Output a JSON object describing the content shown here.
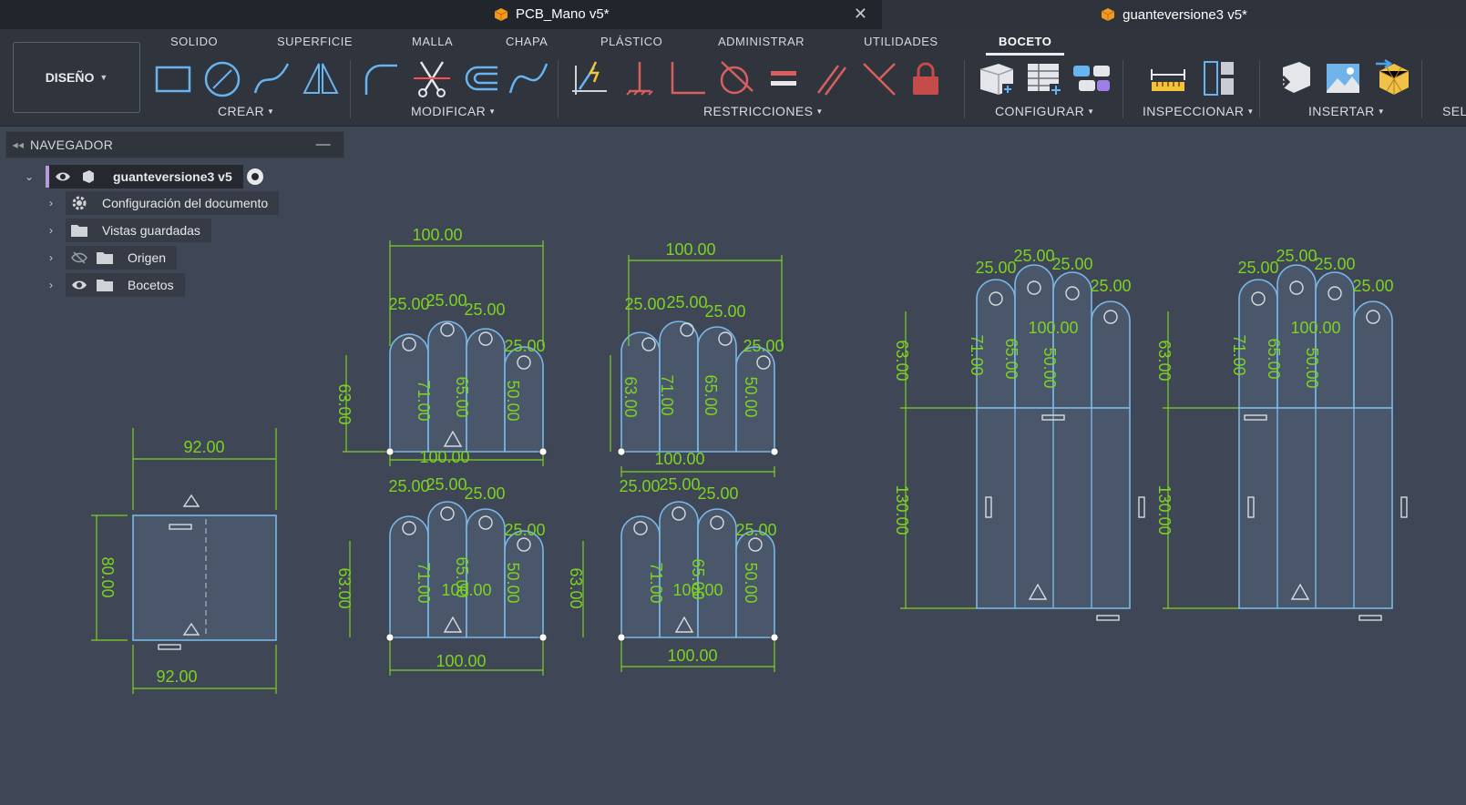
{
  "quick_access": [
    "home-icon",
    "grid-icon",
    "file-icon",
    "save-icon",
    "undo-icon",
    "redo-icon"
  ],
  "tabs": {
    "active": {
      "label": "PCB_Mano v5*"
    },
    "other": {
      "label": "guanteversione3 v5*"
    }
  },
  "workspace": {
    "label": "DISEÑO"
  },
  "categories": [
    "SOLIDO",
    "SUPERFICIE",
    "MALLA",
    "CHAPA",
    "PLÁSTICO",
    "ADMINISTRAR",
    "UTILIDADES",
    "BOCETO"
  ],
  "selected_category": "BOCETO",
  "groups": [
    "CREAR",
    "MODIFICAR",
    "RESTRICCIONES",
    "CONFIGURAR",
    "INSPECCIONAR",
    "INSERTAR",
    "SEL"
  ],
  "navigator": {
    "title": "NAVEGADOR",
    "root": "guanteversione3 v5",
    "items": [
      {
        "label": "Configuración del documento"
      },
      {
        "label": "Vistas guardadas"
      },
      {
        "label": "Origen"
      },
      {
        "label": "Bocetos"
      }
    ]
  },
  "sketch": {
    "square": {
      "top": "92.00",
      "bottom": "92.00",
      "side": "80.00"
    },
    "hand_top": [
      "100.00",
      "25.00",
      "25.00",
      "25.00",
      "25.00",
      "63.00",
      "71.00",
      "65.00",
      "50.00",
      "100.00"
    ],
    "hand_values": [
      "100.00",
      "25.00",
      "63.00",
      "71.00",
      "65.00",
      "50.00",
      "130.00",
      "92.00",
      "80.00"
    ]
  },
  "colors": {
    "accent": "#7cd320",
    "sketch_line": "#79b8e6",
    "background": "#3f4655"
  }
}
